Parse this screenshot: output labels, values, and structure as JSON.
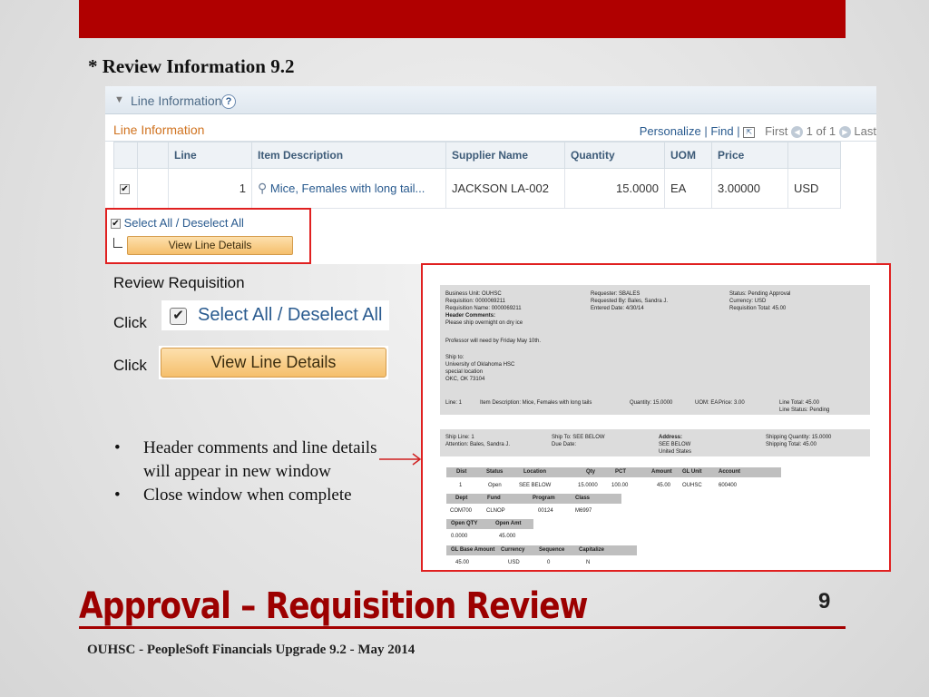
{
  "slide": {
    "heading": "* Review Information 9.2",
    "title": "Approval – Requisition Review",
    "page_number": "9",
    "footer": "OUHSC - PeopleSoft Financials Upgrade 9.2 - May 2014"
  },
  "line_panel": {
    "collapse_title": "Line Information",
    "help_label": "?",
    "grid_title": "Line Information",
    "nav": {
      "personalize": "Personalize",
      "sep": "|",
      "find": "Find",
      "first": "First",
      "range": "1 of 1",
      "last": "Last"
    },
    "columns": [
      "Line",
      "Item Description",
      "Supplier Name",
      "Quantity",
      "UOM",
      "Price"
    ],
    "row": {
      "line": "1",
      "item_description": "Mice, Females with long tail...",
      "supplier_name": "JACKSON LA-002",
      "quantity": "15.0000",
      "uom": "EA",
      "price": "3.00000",
      "currency": "USD"
    },
    "select_all_label": "Select All / Deselect All",
    "view_line_details_label": "View Line Details"
  },
  "instructions": {
    "review_label": "Review Requisition",
    "click1": "Click",
    "click2": "Click",
    "select_all_label": "Select All / Deselect All",
    "view_line_details_label": "View Line Details"
  },
  "bullets": [
    "Header comments and line details   will appear in new window",
    "Close window when complete"
  ],
  "detail": {
    "business_unit": "Business Unit: OUHSC",
    "requisition": "Requisition: 0000069211",
    "requisition_name": "Requisition Name: 0000069211",
    "header_comments": "Header Comments:",
    "comment1": "Please ship overnight on dry ice",
    "comment2": "Professor will need by Friday May 10th.",
    "ship_to": "Ship to:",
    "ship_to_1": "University of Oklahoma HSC",
    "ship_to_2": "special location",
    "ship_to_3": "OKC, OK 73104",
    "requester": "Requester: SBALES",
    "requested_by": "Requested By: Bales, Sandra J.",
    "entered_date": "Entered Date: 4/30/14",
    "status": "Status: Pending Approval",
    "currency": "Currency: USD",
    "req_total": "Requisition Total: 45.00",
    "line": "Line: 1",
    "item_desc": "Item Description: Mice, Females with long tails",
    "quantity": "Quantity: 15.0000",
    "uom": "UOM: EA",
    "price": "Price: 3.00",
    "line_total": "Line Total: 45.00",
    "line_status": "Line Status: Pending",
    "ship_line": "Ship Line: 1",
    "attention": "Attention: Bales, Sandra J.",
    "ship_to_below": "Ship To: SEE BELOW",
    "due_date": "Due Date:",
    "address": "Address:",
    "address_1": "SEE BELOW",
    "address_2": "United States",
    "ship_qty": "Shipping Quantity: 15.0000",
    "ship_total": "Shipping Total: 45.00",
    "dist_headers": [
      "Dist",
      "Status",
      "Location",
      "Qty",
      "PCT",
      "Amount",
      "GL Unit",
      "Account"
    ],
    "dist_values": [
      "1",
      "Open",
      "SEE BELOW",
      "15.0000",
      "100.00",
      "45.00",
      "OUHSC",
      "600400"
    ],
    "cf_headers": [
      "Dept",
      "Fund",
      "Program",
      "Class"
    ],
    "cf_values": [
      "COM700",
      "CLNOP",
      "00124",
      "M6997"
    ],
    "open_headers": [
      "Open QTY",
      "Open Amt"
    ],
    "open_values": [
      "0.0000",
      "45.000"
    ],
    "base_headers": [
      "GL Base Amount",
      "Currency",
      "Sequence",
      "Capitalize"
    ],
    "base_values": [
      "45.00",
      "USD",
      "0",
      "N"
    ]
  },
  "colors": {
    "accent_red": "#b00000",
    "link_blue": "#2a5b8f",
    "button_orange": "#f5bf6c"
  }
}
